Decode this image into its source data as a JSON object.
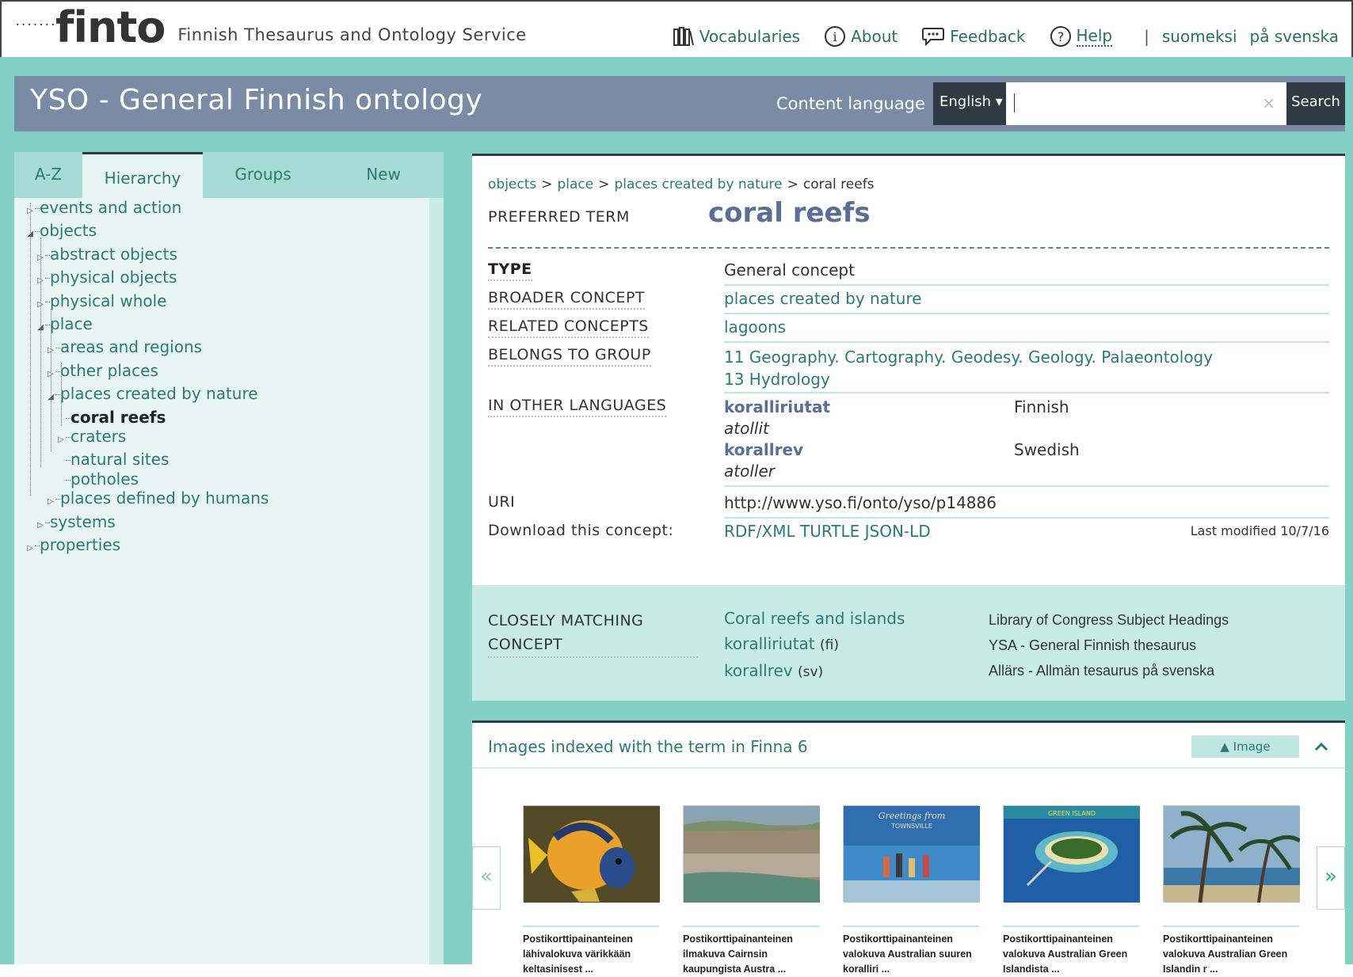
{
  "header": {
    "logo_dots": "·······",
    "logo_word": "finto",
    "tagline": "Finnish Thesaurus and Ontology Service",
    "nav": [
      {
        "label": "Vocabularies",
        "icon": "books-icon"
      },
      {
        "label": "About",
        "icon": "info-icon"
      },
      {
        "label": "Feedback",
        "icon": "speech-bubble-icon"
      },
      {
        "label": "Help",
        "icon": "question-icon"
      }
    ],
    "separator": "|",
    "languages": [
      "suomeksi",
      "på svenska"
    ]
  },
  "vocab": {
    "title": "YSO - General Finnish ontology",
    "content_language_label": "Content language",
    "content_language_value": "English ▾",
    "search_value": "",
    "search_clear": "×",
    "search_button": "Search"
  },
  "sidebar": {
    "tabs": [
      "A-Z",
      "Hierarchy",
      "Groups",
      "New"
    ],
    "active_tab": "Hierarchy",
    "tree": [
      {
        "label": "events and action",
        "depth": 0,
        "toggle": "▷"
      },
      {
        "label": "objects",
        "depth": 0,
        "toggle": "◢"
      },
      {
        "label": "abstract objects",
        "depth": 1,
        "toggle": "▷"
      },
      {
        "label": "physical objects",
        "depth": 1,
        "toggle": "▷"
      },
      {
        "label": "physical whole",
        "depth": 1,
        "toggle": "▷"
      },
      {
        "label": "place",
        "depth": 1,
        "toggle": "◢"
      },
      {
        "label": "areas and regions",
        "depth": 2,
        "toggle": "▷"
      },
      {
        "label": "other places",
        "depth": 2,
        "toggle": "▷"
      },
      {
        "label": "places created by nature",
        "depth": 2,
        "toggle": "◢"
      },
      {
        "label": "coral reefs",
        "depth": 3,
        "toggle": "",
        "current": true
      },
      {
        "label": "craters",
        "depth": 3,
        "toggle": "▷"
      },
      {
        "label": "natural sites",
        "depth": 3,
        "toggle": ""
      },
      {
        "label": "potholes",
        "depth": 3,
        "toggle": ""
      },
      {
        "label": "places defined by humans",
        "depth": 2,
        "toggle": "▷"
      },
      {
        "label": "systems",
        "depth": 1,
        "toggle": "▷"
      },
      {
        "label": "properties",
        "depth": 0,
        "toggle": "▷"
      }
    ]
  },
  "concept": {
    "breadcrumb": [
      {
        "label": "objects",
        "link": true
      },
      {
        "label": "place",
        "link": true
      },
      {
        "label": "places created by nature",
        "link": true
      },
      {
        "label": "coral reefs",
        "link": false
      }
    ],
    "breadcrumb_sep": ">",
    "preferred_term_label": "PREFERRED TERM",
    "preferred_term": "coral reefs",
    "type_label": "TYPE",
    "type_value": "General concept",
    "broader_label": "BROADER CONCEPT",
    "broader_value": "places created by nature",
    "related_label": "RELATED CONCEPTS",
    "related_value": "lagoons",
    "group_label": "BELONGS TO GROUP",
    "groups": [
      "11 Geography. Cartography. Geodesy. Geology. Palaeontology",
      "13 Hydrology"
    ],
    "other_lang_label": "IN OTHER LANGUAGES",
    "other_langs": [
      {
        "term": "koralliriutat",
        "alt": "atollit",
        "language": "Finnish"
      },
      {
        "term": "korallrev",
        "alt": "atoller",
        "language": "Swedish"
      }
    ],
    "uri_label": "URI",
    "uri_value": "http://www.yso.fi/onto/yso/p14886",
    "download_label": "Download this concept:",
    "download_formats": [
      "RDF/XML",
      "TURTLE",
      "JSON-LD"
    ],
    "last_modified": "Last modified 10/7/16"
  },
  "matching": {
    "label_line1": "CLOSELY MATCHING",
    "label_line2": "CONCEPT",
    "items": [
      {
        "term": "Coral reefs and islands",
        "lang": "",
        "source": "Library of Congress Subject Headings"
      },
      {
        "term": "koralliriutat",
        "lang": "(fi)",
        "source": "YSA - General Finnish thesaurus"
      },
      {
        "term": "korallrev",
        "lang": "(sv)",
        "source": "Allärs - Allmän tesaurus på svenska"
      }
    ]
  },
  "images": {
    "heading": "Images indexed with the term in Finna 6",
    "filter_label": "▲ Image",
    "collapse_icon": "^",
    "prev": "«",
    "next": "»",
    "thumbs": [
      {
        "line1": "Postikorttipainanteinen",
        "line2": "lähivalokuva värikkään",
        "line3": "keltasinisest ...",
        "scene": "fish"
      },
      {
        "line1": "Postikorttipainanteinen",
        "line2": "ilmakuva Cairnsin",
        "line3": "kaupungista Austra ...",
        "scene": "aerial"
      },
      {
        "line1": "Postikorttipainanteinen",
        "line2": "valokuva Australian suuren",
        "line3": "koralliri ...",
        "scene": "beach"
      },
      {
        "line1": "Postikorttipainanteinen",
        "line2": "valokuva Australian Green",
        "line3": "Islandista ...",
        "scene": "island"
      },
      {
        "line1": "Postikorttipainanteinen",
        "line2": "valokuva Australian Green",
        "line3": "Islandin r ...",
        "scene": "palms"
      }
    ]
  }
}
